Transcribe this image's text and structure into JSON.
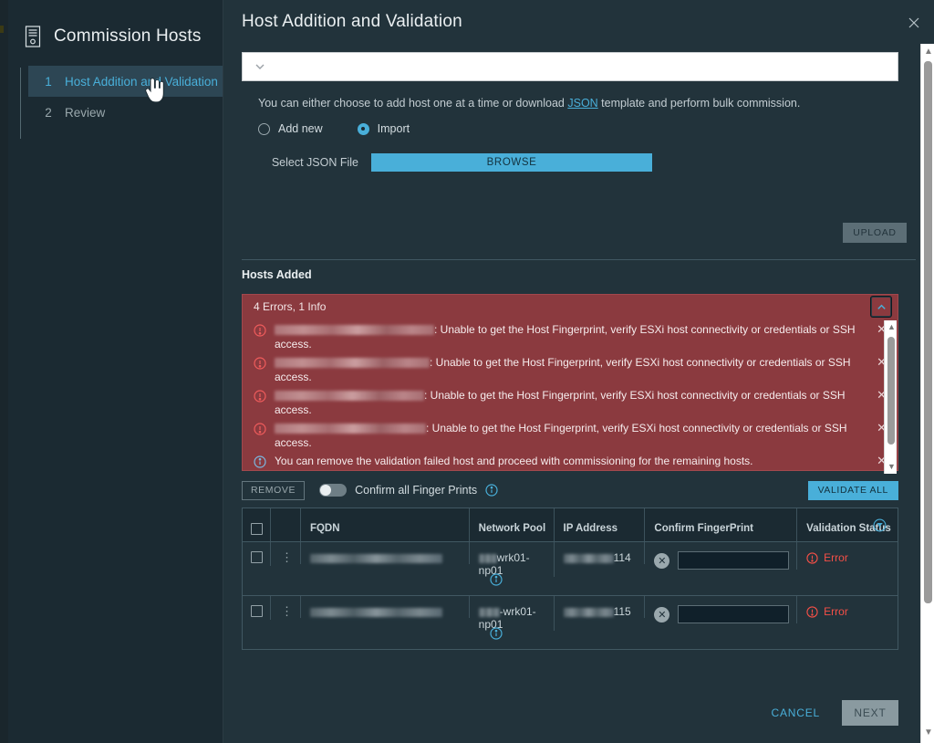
{
  "wizard": {
    "icon": "server-tower-icon",
    "title": "Commission Hosts",
    "steps": [
      {
        "num": "1",
        "label": "Host Addition and Validation",
        "active": true
      },
      {
        "num": "2",
        "label": "Review",
        "active": false
      }
    ]
  },
  "header": {
    "title": "Host Addition and Validation",
    "close_icon": "close-icon"
  },
  "form": {
    "select_value": "",
    "select_chevron_icon": "chevron-down-icon",
    "helper_prefix": "You can either choose to add host one at a time or download ",
    "helper_link": "JSON",
    "helper_suffix": " template and perform bulk commission.",
    "radios": [
      {
        "label": "Add new",
        "checked": false
      },
      {
        "label": "Import",
        "checked": true
      }
    ],
    "file_label": "Select JSON File",
    "browse_label": "BROWSE",
    "upload_label": "UPLOAD"
  },
  "hosts_section": {
    "title": "Hosts Added"
  },
  "alert": {
    "summary": "4 Errors, 1 Info",
    "collapse_icon": "chevron-up-icon",
    "dismiss_icon": "close-icon",
    "error_message": ": Unable to get the Host Fingerprint, verify ESXi host connectivity or SSH access.",
    "items": [
      {
        "type": "error",
        "host": "[redacted]",
        "message": ": Unable to get the Host Fingerprint, verify ESXi host connectivity or credentials or SSH access."
      },
      {
        "type": "error",
        "host": "[redacted]",
        "message": ": Unable to get the Host Fingerprint, verify ESXi host connectivity or credentials or SSH access."
      },
      {
        "type": "error",
        "host": "[redacted]",
        "message": ": Unable to get the Host Fingerprint, verify ESXi host connectivity or credentials or SSH access."
      },
      {
        "type": "error",
        "host": "[redacted]",
        "message": ": Unable to get the Host Fingerprint, verify ESXi host connectivity or credentials or SSH access."
      },
      {
        "type": "info",
        "host": "",
        "message": "You can remove the validation failed host and proceed with commissioning for the remaining hosts."
      }
    ]
  },
  "toolbar": {
    "remove_label": "REMOVE",
    "toggle_label": "Confirm all Finger Prints",
    "toggle_on": false,
    "info_icon": "info-icon",
    "validate_label": "VALIDATE ALL"
  },
  "table": {
    "columns": [
      "",
      "",
      "FQDN",
      "Network Pool",
      "IP Address",
      "Confirm FingerPrint",
      "Validation Status"
    ],
    "filter_icon": "filter-icon",
    "rows": [
      {
        "selected": false,
        "fqdn": "[redacted]",
        "network_pool_prefix": "[redacted]",
        "network_pool": "wrk01-np01",
        "ip_prefix": "[redacted]",
        "ip_suffix": "114",
        "fingerprint": "",
        "fingerprint_action_icon": "circle-x-icon",
        "status": "Error"
      },
      {
        "selected": false,
        "fqdn": "[redacted]",
        "network_pool_prefix": "[redacted]",
        "network_pool": "-wrk01-np01",
        "ip_prefix": "[redacted]",
        "ip_suffix": "115",
        "fingerprint": "",
        "fingerprint_action_icon": "circle-x-icon",
        "status": "Error"
      }
    ]
  },
  "footer": {
    "cancel_label": "CANCEL",
    "next_label": "NEXT"
  },
  "colors": {
    "accent": "#49afd9",
    "alert_bg": "#8b3a3f",
    "error_text": "#f54f47",
    "panel_bg": "#22333b",
    "sidebar_bg": "#1b2a32"
  }
}
